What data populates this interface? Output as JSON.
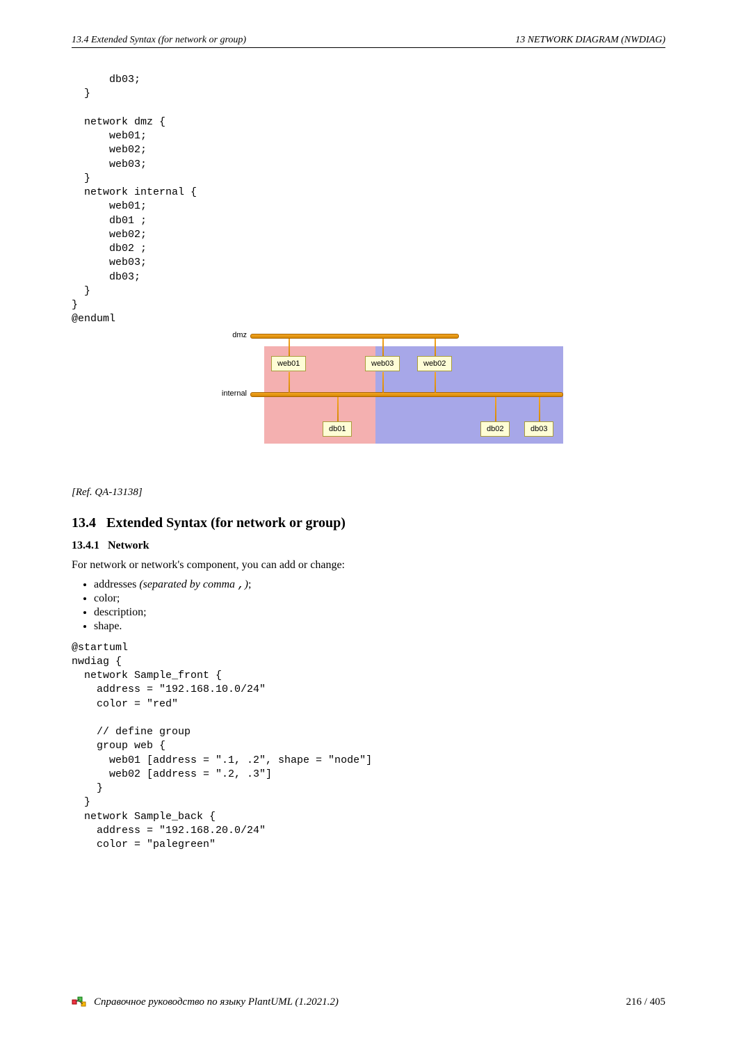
{
  "header": {
    "left": "13.4   Extended Syntax (for network or group)",
    "right": "13   NETWORK DIAGRAM (NWDIAG)"
  },
  "code1": "      db03;\n  }\n\n  network dmz {\n      web01;\n      web02;\n      web03;\n  }\n  network internal {\n      web01;\n      db01 ;\n      web02;\n      db02 ;\n      web03;\n      db03;\n  }\n}\n@enduml",
  "diagram": {
    "labels": {
      "dmz": "dmz",
      "internal": "internal"
    },
    "nodes": {
      "web01": "web01",
      "web03": "web03",
      "web02": "web02",
      "db01": "db01",
      "db02": "db02",
      "db03": "db03"
    }
  },
  "ref": "[Ref. QA-13138]",
  "section_num": "13.4",
  "section_title": "Extended Syntax (for network or group)",
  "subsection_num": "13.4.1",
  "subsection_title": "Network",
  "intro": "For network or network's component, you can add or change:",
  "bullets": {
    "b1a": "addresses ",
    "b1b": "(separated by comma ",
    "b1c": ",",
    "b1d": ")",
    "b1e": ";",
    "b2": "color;",
    "b3": "description;",
    "b4": "shape."
  },
  "code2": "@startuml\nnwdiag {\n  network Sample_front {\n    address = \"192.168.10.0/24\"\n    color = \"red\"\n\n    // define group\n    group web {\n      web01 [address = \".1, .2\", shape = \"node\"]\n      web02 [address = \".2, .3\"]\n    }\n  }\n  network Sample_back {\n    address = \"192.168.20.0/24\"\n    color = \"palegreen\"",
  "footer": {
    "title": "Справочное руководство по языку PlantUML (1.2021.2)",
    "page": "216 / 405"
  }
}
